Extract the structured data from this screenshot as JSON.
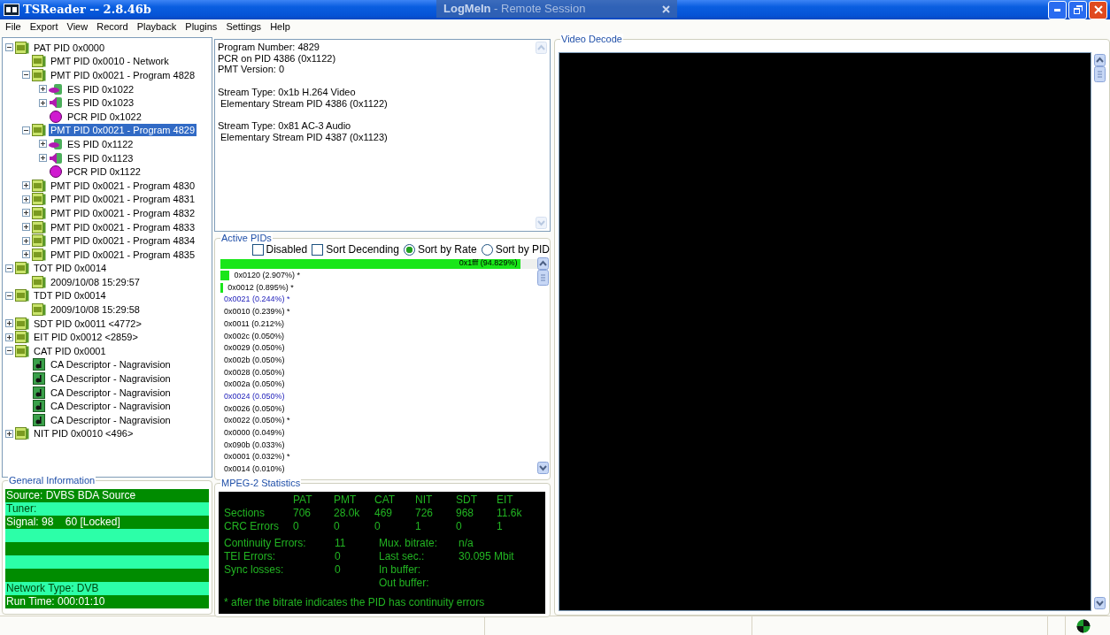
{
  "window": {
    "title": "TSReader -- 2.8.46b",
    "overlay_title": "**LogMeIn** - Remote Session"
  },
  "menu": [
    "File",
    "Export",
    "View",
    "Record",
    "Playback",
    "Plugins",
    "Settings",
    "Help"
  ],
  "tree": [
    {
      "label": "PAT PID 0x0000",
      "kind": "table",
      "expanded": true,
      "selected": false,
      "children": [
        {
          "label": "PMT PID 0x0010 - Network",
          "kind": "table",
          "selected": false
        },
        {
          "label": "PMT PID 0x0021 - Program 4828",
          "kind": "table",
          "expanded": true,
          "selected": false,
          "children": [
            {
              "label": "ES PID 0x1022",
              "kind": "video",
              "expanded": false,
              "selected": false
            },
            {
              "label": "ES PID 0x1023",
              "kind": "audio",
              "expanded": false,
              "selected": false
            },
            {
              "label": "PCR PID 0x1022",
              "kind": "clock",
              "selected": false
            }
          ]
        },
        {
          "label": "PMT PID 0x0021 - Program 4829",
          "kind": "table",
          "expanded": true,
          "selected": true,
          "children": [
            {
              "label": "ES PID 0x1122",
              "kind": "video",
              "expanded": false,
              "selected": false
            },
            {
              "label": "ES PID 0x1123",
              "kind": "audio",
              "expanded": false,
              "selected": false
            },
            {
              "label": "PCR PID 0x1122",
              "kind": "clock",
              "selected": false
            }
          ]
        },
        {
          "label": "PMT PID 0x0021 - Program 4830",
          "kind": "table",
          "expanded": false,
          "selected": false
        },
        {
          "label": "PMT PID 0x0021 - Program 4831",
          "kind": "table",
          "expanded": false,
          "selected": false
        },
        {
          "label": "PMT PID 0x0021 - Program 4832",
          "kind": "table",
          "expanded": false,
          "selected": false
        },
        {
          "label": "PMT PID 0x0021 - Program 4833",
          "kind": "table",
          "expanded": false,
          "selected": false
        },
        {
          "label": "PMT PID 0x0021 - Program 4834",
          "kind": "table",
          "expanded": false,
          "selected": false
        },
        {
          "label": "PMT PID 0x0021 - Program 4835",
          "kind": "table",
          "expanded": false,
          "selected": false
        }
      ]
    },
    {
      "label": "TOT PID 0x0014",
      "kind": "table",
      "expanded": true,
      "selected": false,
      "children": [
        {
          "label": "2009/10/08 15:29:57",
          "kind": "table",
          "selected": false
        }
      ]
    },
    {
      "label": "TDT PID 0x0014",
      "kind": "table",
      "expanded": true,
      "selected": false,
      "children": [
        {
          "label": "2009/10/08 15:29:58",
          "kind": "table",
          "selected": false
        }
      ]
    },
    {
      "label": "SDT PID 0x0011 <4772>",
      "kind": "table",
      "expanded": false,
      "selected": false
    },
    {
      "label": "EIT PID 0x0012 <2859>",
      "kind": "table",
      "expanded": false,
      "selected": false
    },
    {
      "label": "CAT PID 0x0001",
      "kind": "table",
      "expanded": true,
      "selected": false,
      "children": [
        {
          "label": "CA Descriptor - Nagravision",
          "kind": "descriptor",
          "selected": false
        },
        {
          "label": "CA Descriptor - Nagravision",
          "kind": "descriptor",
          "selected": false
        },
        {
          "label": "CA Descriptor - Nagravision",
          "kind": "descriptor",
          "selected": false
        },
        {
          "label": "CA Descriptor - Nagravision",
          "kind": "descriptor",
          "selected": false
        },
        {
          "label": "CA Descriptor - Nagravision",
          "kind": "descriptor",
          "selected": false
        }
      ]
    },
    {
      "label": "NIT PID 0x0010 <496>",
      "kind": "table",
      "expanded": false,
      "selected": false
    }
  ],
  "program_info": {
    "summary": [
      "Program Number: 4829",
      "PCR on PID 4386 (0x1122)",
      "PMT Version: 0"
    ],
    "streams": [
      {
        "type": "Stream Type: 0x1b H.264 Video",
        "pid": "Elementary Stream PID 4386 (0x1122)"
      },
      {
        "type": "Stream Type: 0x81 AC-3 Audio",
        "pid": "Elementary Stream PID 4387 (0x1123)"
      }
    ]
  },
  "active_pids": {
    "title": "Active PIDs",
    "options": [
      {
        "kind": "checkbox",
        "label": "Disabled",
        "checked": false
      },
      {
        "kind": "checkbox",
        "label": "Sort Decending",
        "checked": false
      },
      {
        "kind": "radio",
        "label": "Sort by Rate",
        "selected": true
      },
      {
        "kind": "radio",
        "label": "Sort by PID",
        "selected": false
      }
    ],
    "rows": [
      {
        "label": "0x1fff (94.829%)",
        "level": 0.948,
        "highlighted": false
      },
      {
        "label": "0x0120 (2.907%) *",
        "level": 0.029,
        "highlighted": false
      },
      {
        "label": "0x0012 (0.895%) *",
        "level": 0.009,
        "highlighted": false
      },
      {
        "label": "0x0021 (0.244%) *",
        "highlighted": true
      },
      {
        "label": "0x0010 (0.239%) *",
        "highlighted": false
      },
      {
        "label": "0x0011 (0.212%)",
        "highlighted": false
      },
      {
        "label": "0x002c (0.050%)",
        "highlighted": false
      },
      {
        "label": "0x0029 (0.050%)",
        "highlighted": false
      },
      {
        "label": "0x002b (0.050%)",
        "highlighted": false
      },
      {
        "label": "0x0028 (0.050%)",
        "highlighted": false
      },
      {
        "label": "0x002a (0.050%)",
        "highlighted": false
      },
      {
        "label": "0x0024 (0.050%)",
        "highlighted": true
      },
      {
        "label": "0x0026 (0.050%)",
        "highlighted": false
      },
      {
        "label": "0x0022 (0.050%) *",
        "highlighted": false
      },
      {
        "label": "0x0000 (0.049%)",
        "highlighted": false
      },
      {
        "label": "0x090b (0.033%)",
        "highlighted": false
      },
      {
        "label": "0x0001 (0.032%) *",
        "highlighted": false
      },
      {
        "label": "0x0014 (0.010%)",
        "highlighted": false
      }
    ]
  },
  "general_info": {
    "title": "General Information",
    "rows": [
      {
        "text": "Source: DVBS BDA Source"
      },
      {
        "text": "Tuner:"
      },
      {
        "text": "Signal: 98    60 [Locked]"
      },
      {},
      {},
      {},
      {},
      {
        "text": "Network Type: DVB"
      },
      {
        "text": "Run Time: 000:01:10"
      }
    ]
  },
  "statistics": {
    "title": "MPEG-2 Statistics",
    "columns": [
      "PAT",
      "PMT",
      "CAT",
      "NIT",
      "SDT",
      "EIT"
    ],
    "rows": [
      {
        "label": "Sections",
        "values": [
          "706",
          "28.0k",
          "469",
          "726",
          "968",
          "11.6k"
        ]
      },
      {
        "label": "CRC Errors",
        "values": [
          "0",
          "0",
          "0",
          "1",
          "0",
          "1"
        ]
      }
    ],
    "errors": [
      {
        "label": "Continuity Errors:",
        "value": "11"
      },
      {
        "label": "TEI Errors:",
        "value": "0"
      },
      {
        "label": "Sync losses:",
        "value": "0"
      }
    ],
    "bitrates": [
      {
        "label": "Mux. bitrate:",
        "value": "n/a"
      },
      {
        "label": "Last sec.:",
        "value": "30.095 Mbit"
      },
      {
        "label": "In buffer:"
      },
      {
        "label": "Out buffer:"
      }
    ],
    "note": "* after the bitrate indicates the PID has continuity errors"
  },
  "video": {
    "title": "Video Decode"
  }
}
